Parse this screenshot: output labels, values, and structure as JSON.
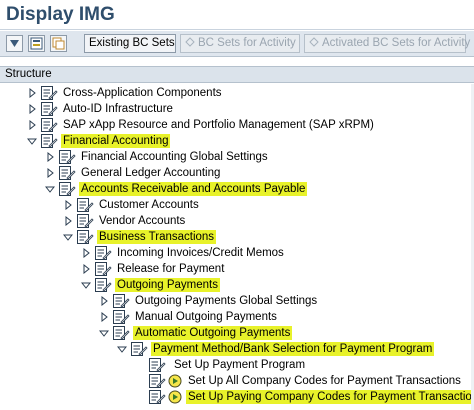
{
  "window": {
    "title": "Display IMG"
  },
  "toolbar": {
    "existing_bc_sets": "Existing BC Sets",
    "bc_sets_for_activity": "BC Sets for Activity",
    "activated_bc_sets_for_activity": "Activated BC Sets for Activity"
  },
  "structure": {
    "header": "Structure"
  },
  "tree": [
    {
      "label": "Cross-Application Components",
      "state": "collapsed",
      "highlighted": false
    },
    {
      "label": "Auto-ID Infrastructure",
      "state": "collapsed",
      "highlighted": false
    },
    {
      "label": "SAP xApp Resource and Portfolio Management (SAP xRPM)",
      "state": "collapsed",
      "highlighted": false
    },
    {
      "label": "Financial Accounting",
      "state": "expanded",
      "highlighted": true
    },
    {
      "label": "Financial Accounting Global Settings",
      "state": "collapsed",
      "highlighted": false
    },
    {
      "label": "General Ledger Accounting",
      "state": "collapsed",
      "highlighted": false
    },
    {
      "label": "Accounts Receivable and Accounts Payable",
      "state": "expanded",
      "highlighted": true
    },
    {
      "label": "Customer Accounts",
      "state": "collapsed",
      "highlighted": false
    },
    {
      "label": "Vendor Accounts",
      "state": "collapsed",
      "highlighted": false
    },
    {
      "label": "Business Transactions",
      "state": "expanded",
      "highlighted": true
    },
    {
      "label": "Incoming Invoices/Credit Memos",
      "state": "collapsed",
      "highlighted": false
    },
    {
      "label": "Release for Payment",
      "state": "collapsed",
      "highlighted": false
    },
    {
      "label": "Outgoing Payments",
      "state": "expanded",
      "highlighted": true
    },
    {
      "label": "Outgoing Payments Global Settings",
      "state": "collapsed",
      "highlighted": false
    },
    {
      "label": "Manual Outgoing Payments",
      "state": "collapsed",
      "highlighted": false
    },
    {
      "label": "Automatic Outgoing Payments",
      "state": "expanded",
      "highlighted": true
    },
    {
      "label": "Payment Method/Bank Selection for Payment Program",
      "state": "expanded",
      "highlighted": true
    },
    {
      "label": "Set Up Payment Program",
      "state": "leaf",
      "highlighted": false
    },
    {
      "label": "Set Up All Company Codes for Payment Transactions",
      "state": "leaf",
      "highlighted": false
    },
    {
      "label": "Set Up Paying Company Codes for Payment Transactions",
      "state": "leaf",
      "highlighted": true
    }
  ],
  "colors": {
    "highlight": "#e8f22a",
    "title": "#2f4e6c",
    "toolbar_bg": "#dfe6ee",
    "header_bg": "#dbe3eb"
  },
  "icons": {
    "expand": "triangle-right-icon",
    "collapse": "triangle-down-icon",
    "node": "img-activity-document-icon",
    "execute": "execute-clock-icon"
  }
}
